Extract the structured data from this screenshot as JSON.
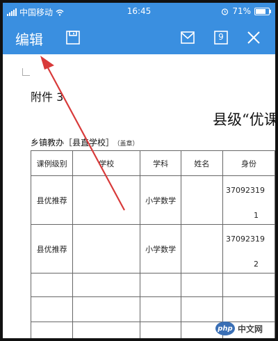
{
  "status_bar": {
    "carrier": "中国移动",
    "time": "16:45",
    "battery": "71%"
  },
  "toolbar": {
    "edit_label": "编辑",
    "tab_count": "9"
  },
  "document": {
    "attachment_label": "附件 3",
    "title": "县级“优课",
    "subline": "乡镇教办［县直学校］",
    "seal": "（盖章）",
    "table": {
      "headers": [
        "课例级别",
        "学校",
        "学科",
        "姓名",
        "身份"
      ],
      "rows": [
        {
          "level": "县优推荐",
          "school": "",
          "subject": "小学数学",
          "name": "",
          "id_top": "37092319",
          "id_bot": "1"
        },
        {
          "level": "县优推荐",
          "school": "",
          "subject": "小学数学",
          "name": "",
          "id_top": "37092319",
          "id_bot": "2"
        }
      ]
    }
  },
  "watermark": {
    "logo": "php",
    "text": "中文网"
  }
}
